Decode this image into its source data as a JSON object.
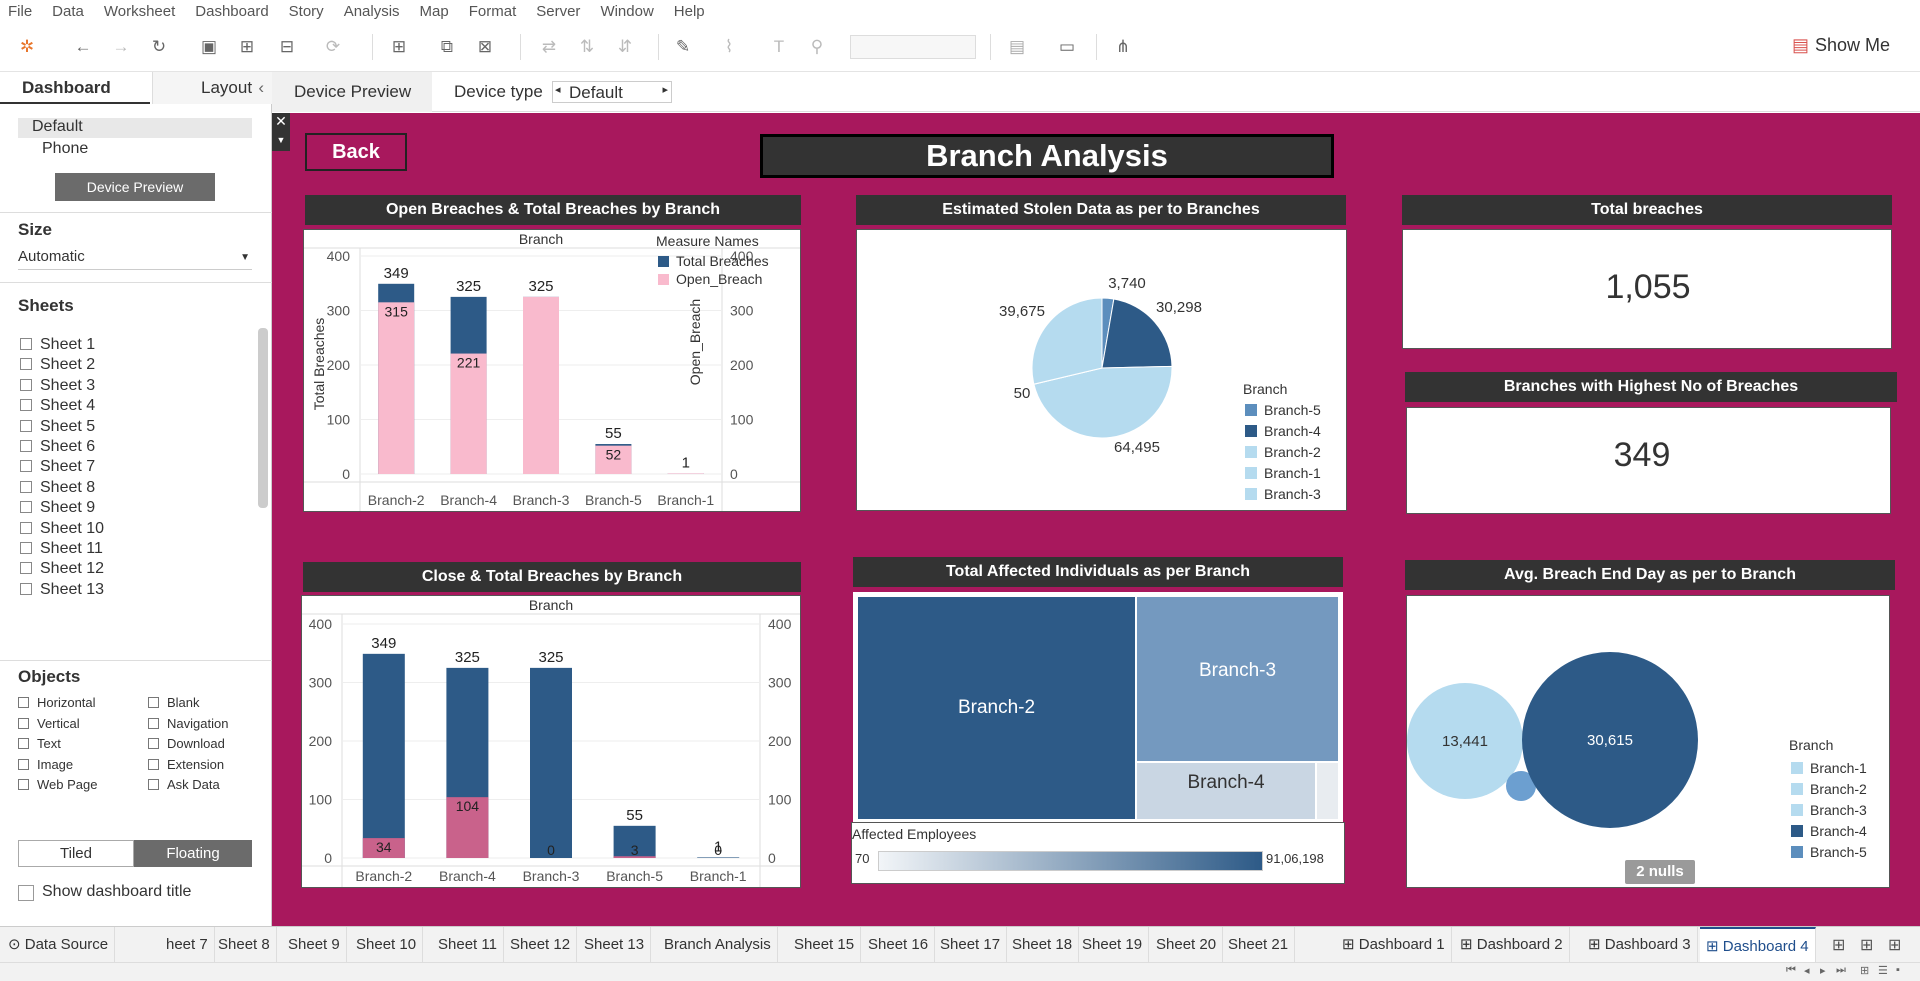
{
  "menu": [
    "File",
    "Data",
    "Worksheet",
    "Dashboard",
    "Story",
    "Analysis",
    "Map",
    "Format",
    "Server",
    "Window",
    "Help"
  ],
  "toolbar": {
    "show_me": "Show Me"
  },
  "left_panel": {
    "tab_dashboard": "Dashboard",
    "tab_layout": "Layout",
    "device_default": "Default",
    "device_phone": "Phone",
    "device_preview_button": "Device Preview",
    "size_header": "Size",
    "size_value": "Automatic",
    "sheets_header": "Sheets",
    "sheets": [
      "Sheet 1",
      "Sheet 2",
      "Sheet 3",
      "Sheet 4",
      "Sheet 5",
      "Sheet 6",
      "Sheet 7",
      "Sheet 8",
      "Sheet 9",
      "Sheet 10",
      "Sheet 11",
      "Sheet 12",
      "Sheet 13"
    ],
    "objects_header": "Objects",
    "objects_left": [
      "Horizontal",
      "Vertical",
      "Text",
      "Image",
      "Web Page"
    ],
    "objects_right": [
      "Blank",
      "Navigation",
      "Download",
      "Extension",
      "Ask Data"
    ],
    "tiled": "Tiled",
    "floating": "Floating",
    "show_title": "Show dashboard title"
  },
  "device_bar": {
    "preview": "Device Preview",
    "type_label": "Device type",
    "type_value": "Default"
  },
  "dashboard": {
    "back": "Back",
    "title": "Branch Analysis",
    "p1_title": "Open Breaches & Total Breaches by Branch",
    "p2_title": "Estimated Stolen Data as per to Branches",
    "p3_title": "Total breaches",
    "p3_value": "1,055",
    "p4_title": "Branches with Highest No of Breaches",
    "p4_value": "349",
    "p5_title": "Close & Total Breaches by Branch",
    "p6_title": "Total Affected Individuals as per Branch",
    "p7_title": "Avg. Breach End Day as per to Branch",
    "branch_header": "Branch",
    "p1_legend_title": "Measure Names",
    "p1_legend": [
      "Total Breaches",
      "Open_Breach"
    ],
    "p1_yleft": "Total Breaches",
    "p1_yright": "Open_Breach",
    "p6_legend_title": "Affected Employees",
    "p6_legend_min": "70",
    "p6_legend_max": "91,06,198",
    "p7_nulls": "2 nulls"
  },
  "colors": {
    "dark": "#2d5a87",
    "pink": "#f9bacd",
    "darkpink": "#c9628b",
    "light": "#b5dbef",
    "mid": "#5c8ebd",
    "bg": "#a8185d"
  },
  "chart_data": [
    {
      "type": "bar",
      "title": "Open Breaches & Total Breaches by Branch",
      "categories": [
        "Branch-2",
        "Branch-4",
        "Branch-3",
        "Branch-5",
        "Branch-1"
      ],
      "series": [
        {
          "name": "Total Breaches",
          "values": [
            349,
            325,
            325,
            55,
            1
          ]
        },
        {
          "name": "Open_Breach",
          "values": [
            315,
            221,
            325,
            52,
            1
          ]
        }
      ],
      "ylim": [
        0,
        400
      ],
      "yticks": [
        "400",
        "300",
        "200",
        "100",
        "0"
      ],
      "labels_total": [
        "349",
        "325",
        "325",
        "55",
        "1"
      ],
      "labels_open": [
        "315",
        "221",
        "",
        "52",
        ""
      ]
    },
    {
      "type": "pie",
      "title": "Estimated Stolen Data as per to Branches",
      "slices": [
        {
          "label": "3,740",
          "value": 3740,
          "branch": "Branch-5"
        },
        {
          "label": "30,298",
          "value": 30298,
          "branch": "Branch-4"
        },
        {
          "label": "64,495",
          "value": 64495,
          "branch": "Branch-2"
        },
        {
          "label": "50",
          "value": 50,
          "branch": "Branch-1"
        },
        {
          "label": "39,675",
          "value": 39675,
          "branch": "Branch-3"
        }
      ],
      "legend_title": "Branch",
      "legend": [
        "Branch-5",
        "Branch-4",
        "Branch-2",
        "Branch-1",
        "Branch-3"
      ]
    },
    {
      "type": "bar",
      "title": "Close & Total Breaches by Branch",
      "categories": [
        "Branch-2",
        "Branch-4",
        "Branch-3",
        "Branch-5",
        "Branch-1"
      ],
      "series": [
        {
          "name": "Total Breaches",
          "values": [
            349,
            325,
            325,
            55,
            1
          ]
        },
        {
          "name": "Close Breaches",
          "values": [
            34,
            104,
            0,
            3,
            0
          ]
        }
      ],
      "ylim": [
        0,
        400
      ],
      "yticks": [
        "400",
        "300",
        "200",
        "100",
        "0"
      ],
      "labels_total": [
        "349",
        "325",
        "325",
        "55",
        "1"
      ],
      "labels_close": [
        "34",
        "104",
        "0",
        "3",
        "0"
      ]
    },
    {
      "type": "heatmap",
      "title": "Total Affected Individuals as per Branch",
      "cells": [
        {
          "label": "Branch-2"
        },
        {
          "label": "Branch-3"
        },
        {
          "label": "Branch-4"
        },
        {
          "label": ""
        }
      ]
    },
    {
      "type": "scatter",
      "title": "Avg. Breach End Day as per to Branch",
      "bubbles": [
        {
          "label": "13,441",
          "value": 13441
        },
        {
          "label": "",
          "value": 0
        },
        {
          "label": "30,615",
          "value": 30615
        }
      ],
      "legend_title": "Branch",
      "legend": [
        "Branch-1",
        "Branch-2",
        "Branch-3",
        "Branch-4",
        "Branch-5"
      ]
    }
  ],
  "bottom_tabs": [
    "Data Source",
    "heet 7",
    "Sheet 8",
    "Sheet 9",
    "Sheet 10",
    "Sheet 11",
    "Sheet 12",
    "Sheet 13",
    "Branch Analysis",
    "Sheet 15",
    "Sheet 16",
    "Sheet 17",
    "Sheet 18",
    "Sheet 19",
    "Sheet 20",
    "Sheet 21",
    "Dashboard 1",
    "Dashboard 2",
    "Dashboard 3",
    "Dashboard 4"
  ]
}
